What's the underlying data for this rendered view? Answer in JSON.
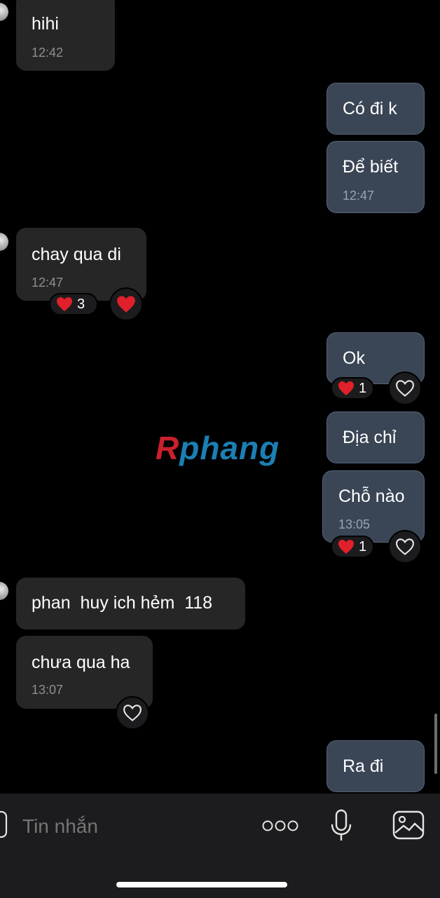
{
  "messages": [
    {
      "id": "m1",
      "side": "in",
      "text": "hihi",
      "time": "12:42"
    },
    {
      "id": "m2",
      "side": "out",
      "text": "Có đi k"
    },
    {
      "id": "m3",
      "side": "out",
      "text": "Để biết",
      "time": "12:47"
    },
    {
      "id": "m4",
      "side": "in",
      "text": "chay qua di",
      "time": "12:47",
      "reaction_count": "3"
    },
    {
      "id": "m5",
      "side": "out",
      "text": "Ok",
      "reaction_count": "1"
    },
    {
      "id": "m6",
      "side": "out",
      "text": "Địa chỉ"
    },
    {
      "id": "m7",
      "side": "out",
      "text": "Chỗ nào",
      "time": "13:05",
      "reaction_count": "1"
    },
    {
      "id": "m8",
      "side": "in",
      "text": "phan  huy ich hẻm  118"
    },
    {
      "id": "m9",
      "side": "in",
      "text": "chưa qua ha",
      "time": "13:07"
    },
    {
      "id": "m10",
      "side": "out",
      "text": "Ra đi"
    }
  ],
  "watermark": {
    "first": "R",
    "rest": "phang"
  },
  "composer": {
    "placeholder": "Tin nhắn"
  },
  "icons": [
    "heart-icon",
    "heart-outline-icon",
    "more-icon",
    "microphone-icon",
    "image-icon",
    "camera-icon"
  ],
  "colors": {
    "incoming_bubble": "#262626",
    "outgoing_bubble": "#3a4555",
    "reaction_heart": "#e0202b"
  }
}
